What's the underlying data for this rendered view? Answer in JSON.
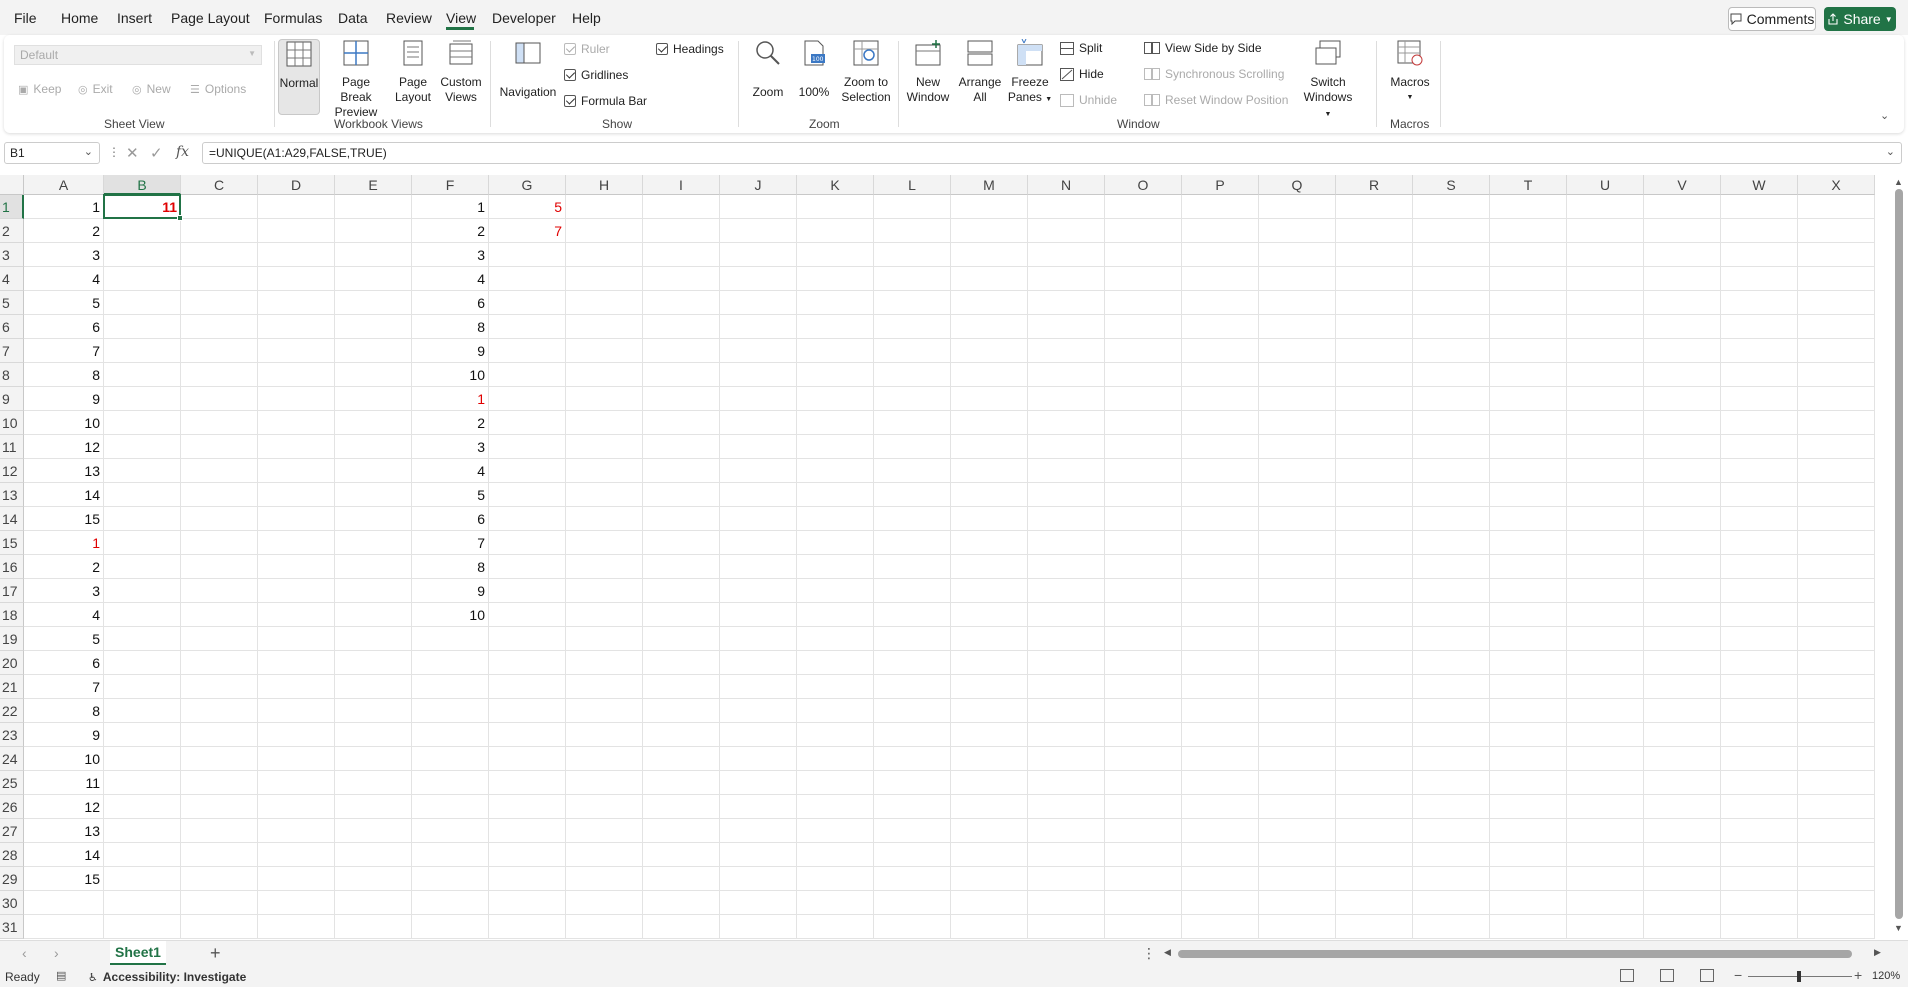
{
  "menu": {
    "items": [
      "File",
      "Home",
      "Insert",
      "Page Layout",
      "Formulas",
      "Data",
      "Review",
      "View",
      "Developer",
      "Help"
    ],
    "active": "View",
    "comments_label": "Comments",
    "share_label": "Share"
  },
  "ribbon": {
    "sheet_view": {
      "select_value": "Default",
      "keep": "Keep",
      "exit": "Exit",
      "new": "New",
      "options": "Options",
      "label": "Sheet View"
    },
    "workbook_views": {
      "normal": "Normal",
      "page_break_1": "Page Break",
      "page_break_2": "Preview",
      "page_layout_1": "Page",
      "page_layout_2": "Layout",
      "custom_1": "Custom",
      "custom_2": "Views",
      "label": "Workbook Views"
    },
    "show": {
      "navigation": "Navigation",
      "ruler": "Ruler",
      "gridlines": "Gridlines",
      "formula_bar": "Formula Bar",
      "headings": "Headings",
      "label": "Show"
    },
    "zoom": {
      "zoom": "Zoom",
      "hundred": "100%",
      "zoom_sel_1": "Zoom to",
      "zoom_sel_2": "Selection",
      "label": "Zoom"
    },
    "window": {
      "new_1": "New",
      "new_2": "Window",
      "arrange_1": "Arrange",
      "arrange_2": "All",
      "freeze_1": "Freeze",
      "freeze_2": "Panes",
      "split": "Split",
      "hide": "Hide",
      "unhide": "Unhide",
      "side_by_side": "View Side by Side",
      "sync_scroll": "Synchronous Scrolling",
      "reset_pos": "Reset Window Position",
      "switch_1": "Switch",
      "switch_2": "Windows",
      "label": "Window"
    },
    "macros": {
      "macros": "Macros",
      "label": "Macros"
    }
  },
  "formula_bar": {
    "name_box": "B1",
    "fx": "fx",
    "formula": "=UNIQUE(A1:A29,FALSE,TRUE)"
  },
  "sheet": {
    "columns": [
      "A",
      "B",
      "C",
      "D",
      "E",
      "F",
      "G",
      "H",
      "I",
      "J",
      "K",
      "L",
      "M",
      "N",
      "O",
      "P",
      "Q",
      "R",
      "S",
      "T",
      "U",
      "V",
      "W",
      "X"
    ],
    "rows": [
      "1",
      "2",
      "3",
      "4",
      "5",
      "6",
      "7",
      "8",
      "9",
      "10",
      "11",
      "12",
      "13",
      "14",
      "15",
      "16",
      "17",
      "18",
      "19",
      "20",
      "21",
      "22",
      "23",
      "24",
      "25",
      "26",
      "27",
      "28",
      "29",
      "30",
      "31"
    ],
    "selected_col": "B",
    "selected_row": "1",
    "col_a": [
      "1",
      "2",
      "3",
      "4",
      "5",
      "6",
      "7",
      "8",
      "9",
      "10",
      "12",
      "13",
      "14",
      "15",
      "1",
      "2",
      "3",
      "4",
      "5",
      "6",
      "7",
      "8",
      "9",
      "10",
      "11",
      "12",
      "13",
      "14",
      "15"
    ],
    "col_a_red_rows": [
      15
    ],
    "col_b": [
      "11"
    ],
    "col_f": [
      "1",
      "2",
      "3",
      "4",
      "6",
      "8",
      "9",
      "10",
      "1",
      "2",
      "3",
      "4",
      "5",
      "6",
      "7",
      "8",
      "9",
      "10"
    ],
    "col_f_red_rows": [
      9
    ],
    "col_g": [
      "5",
      "7"
    ]
  },
  "tabs": {
    "sheet_name": "Sheet1",
    "add": "+",
    "more": "⋮"
  },
  "status": {
    "ready": "Ready",
    "accessibility": "Accessibility: Investigate",
    "zoom_level": "120%"
  },
  "colors": {
    "accent": "#217346",
    "red_text": "#e00000"
  }
}
